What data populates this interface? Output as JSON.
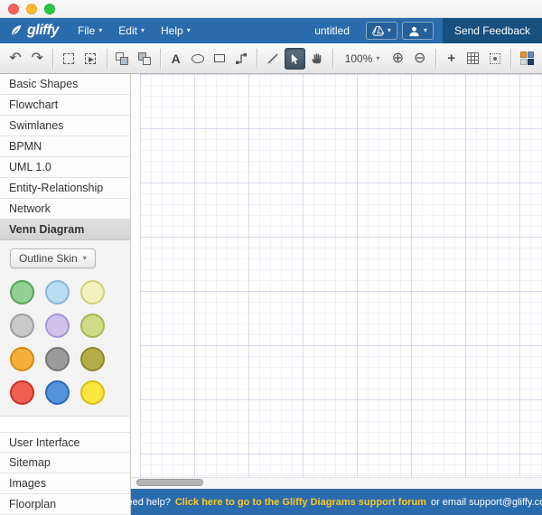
{
  "colors": {
    "navbar_bg": "#2a6bad",
    "send_feedback_bg": "#17507f",
    "help_bar_bg": "#2a6bad",
    "help_link": "#fdc821",
    "traffic": {
      "red": "#ff5f57",
      "yellow": "#febc2e",
      "green": "#28c840"
    },
    "theme_swatch": {
      "a": "#e8912d",
      "b": "#5b8ec4",
      "c": "#dcdcdc",
      "d": "#1f3f66"
    }
  },
  "icons": {
    "chevron_down": "▾",
    "undo": "↶",
    "redo": "↷",
    "zoom_in": "⊕",
    "zoom_out": "⊖",
    "guides_plus": "+",
    "text_tool": "A"
  },
  "navbar": {
    "brand": "gliffy",
    "menus": [
      {
        "label": "File"
      },
      {
        "label": "Edit"
      },
      {
        "label": "Help"
      }
    ],
    "document_title": "untitled",
    "send_feedback_label": "Send Feedback"
  },
  "toolbar": {
    "zoom_level": "100%"
  },
  "sidebar": {
    "top_items": [
      "Basic Shapes",
      "Flowchart",
      "Swimlanes",
      "BPMN",
      "UML 1.0",
      "Entity-Relationship",
      "Network"
    ],
    "selected_item": "Venn Diagram",
    "skin_label": "Outline Skin",
    "venn": [
      {
        "name": "green",
        "fill": "#94cf94",
        "border": "#55a555"
      },
      {
        "name": "light-blue",
        "fill": "#badcf0",
        "border": "#8ab8d8"
      },
      {
        "name": "pale-yellow",
        "fill": "#f2f2bc",
        "border": "#cfcf7a"
      },
      {
        "name": "gray",
        "fill": "#c9c9c9",
        "border": "#9e9e9e"
      },
      {
        "name": "lavender",
        "fill": "#cfc3ea",
        "border": "#a795d6"
      },
      {
        "name": "yellow-green",
        "fill": "#cfdc85",
        "border": "#a8b455"
      },
      {
        "name": "orange",
        "fill": "#f5af3d",
        "border": "#d9880f"
      },
      {
        "name": "dark-gray",
        "fill": "#9b9b9b",
        "border": "#767676"
      },
      {
        "name": "olive",
        "fill": "#b5ad49",
        "border": "#8f8823"
      },
      {
        "name": "red",
        "fill": "#f05f52",
        "border": "#cc2f24"
      },
      {
        "name": "blue",
        "fill": "#5592dc",
        "border": "#2a6ab8"
      },
      {
        "name": "yellow",
        "fill": "#fbe63f",
        "border": "#d9be16"
      }
    ],
    "bottom_items": [
      "User Interface",
      "Sitemap",
      "Images",
      "Floorplan"
    ]
  },
  "helpbar": {
    "prefix": "Need help?",
    "link": "Click here to go to the Gliffy Diagrams support forum",
    "suffix": "or email support@gliffy.com"
  }
}
